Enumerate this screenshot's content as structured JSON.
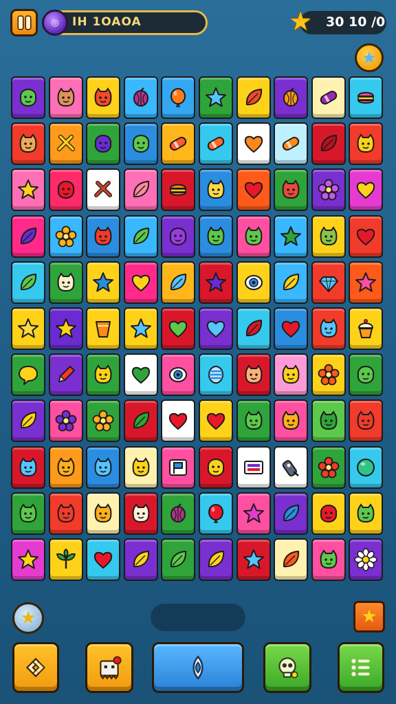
{
  "top_bar": {
    "level_text": "IH 1OAOA",
    "score_text": "30 10 /0",
    "orb_glyph": "◎"
  },
  "board": {
    "rows": [
      [
        {
          "bg": "#7a2fd0",
          "icon": "blob",
          "fg": "#5cc94a",
          "name": "green-blob-icon"
        },
        {
          "bg": "#ff6fb5",
          "icon": "face",
          "fg": "#e0925a",
          "name": "tan-face-icon"
        },
        {
          "bg": "#ffd21a",
          "icon": "face",
          "fg": "#f24a2a",
          "name": "red-face-icon"
        },
        {
          "bg": "#39b7ff",
          "icon": "fruit",
          "fg": "#b0348a",
          "name": "purple-fruit-icon"
        },
        {
          "bg": "#34a7f2",
          "icon": "balloon",
          "fg": "#ff7a1a",
          "name": "orange-balloon-icon"
        },
        {
          "bg": "#2fa43a",
          "icon": "star",
          "fg": "#56c4ff",
          "name": "blue-star-icon"
        },
        {
          "bg": "#ffd21a",
          "icon": "leaf",
          "fg": "#f24a2a",
          "name": "red-leaf-icon"
        },
        {
          "bg": "#7a2fd0",
          "icon": "fruit",
          "fg": "#ff9a1a",
          "name": "orange-fruit-icon"
        },
        {
          "bg": "#fff2b0",
          "icon": "capsule",
          "fg": "#9a2ab3",
          "name": "capsule-icon"
        },
        {
          "bg": "#36c9ee",
          "icon": "burger",
          "fg": "#e44ea0",
          "name": "burger-icon"
        }
      ],
      [
        {
          "bg": "#f23b2a",
          "icon": "face",
          "fg": "#f0a85a",
          "name": "cat-face-icon"
        },
        {
          "bg": "#ff9a1a",
          "icon": "cross",
          "fg": "#ffd21a",
          "name": "crossed-tools-icon"
        },
        {
          "bg": "#2fa43a",
          "icon": "blob",
          "fg": "#6a2bd0",
          "name": "purple-blob-icon"
        },
        {
          "bg": "#2b8de0",
          "icon": "blob",
          "fg": "#5cc94a",
          "name": "green-blob-icon"
        },
        {
          "bg": "#ffb61a",
          "icon": "capsule",
          "fg": "#ff5a2a",
          "name": "candy-icon"
        },
        {
          "bg": "#36c9ee",
          "icon": "capsule",
          "fg": "#ff6a2a",
          "name": "sausage-icon"
        },
        {
          "bg": "#ffffff",
          "icon": "heart",
          "fg": "#ff8a1a",
          "name": "orange-heart-icon"
        },
        {
          "bg": "#bff0ff",
          "icon": "capsule",
          "fg": "#ff8a1a",
          "name": "orange-candy-icon"
        },
        {
          "bg": "#d8182a",
          "icon": "leaf",
          "fg": "#b81020",
          "name": "red-leaf-icon"
        },
        {
          "bg": "#f23b2a",
          "icon": "face",
          "fg": "#ffd21a",
          "name": "yellow-face-icon"
        }
      ],
      [
        {
          "bg": "#ff6fb5",
          "icon": "star",
          "fg": "#ffd21a",
          "name": "yellow-star-icon"
        },
        {
          "bg": "#ff2a6a",
          "icon": "blob",
          "fg": "#e8182a",
          "name": "red-blob-icon"
        },
        {
          "bg": "#ffffff",
          "icon": "cross",
          "fg": "#c7442a",
          "name": "crossed-tools-icon"
        },
        {
          "bg": "#ff6fb5",
          "icon": "leaf",
          "fg": "#ff8aa0",
          "name": "pink-leaf-icon"
        },
        {
          "bg": "#d8182a",
          "icon": "burger",
          "fg": "#ff8a1a",
          "name": "orange-burger-icon"
        },
        {
          "bg": "#2b8de0",
          "icon": "face",
          "fg": "#ffd84a",
          "name": "bear-face-icon"
        },
        {
          "bg": "#ff5a1a",
          "icon": "heart",
          "fg": "#e8182a",
          "name": "red-heart-icon"
        },
        {
          "bg": "#2fa43a",
          "icon": "face",
          "fg": "#e84a3a",
          "name": "red-face-icon"
        },
        {
          "bg": "#7a2fd0",
          "icon": "flower",
          "fg": "#c05ae8",
          "name": "purple-flower-icon"
        },
        {
          "bg": "#e53bd0",
          "icon": "heart",
          "fg": "#ffd21a",
          "name": "yellow-heart-icon"
        }
      ],
      [
        {
          "bg": "#ff2a8a",
          "icon": "leaf",
          "fg": "#6a2bd0",
          "name": "purple-leaf-icon"
        },
        {
          "bg": "#39b7ff",
          "icon": "flower",
          "fg": "#ffb01a",
          "name": "orange-flower-icon"
        },
        {
          "bg": "#2b8de0",
          "icon": "face",
          "fg": "#f23b2a",
          "name": "red-face-icon"
        },
        {
          "bg": "#39b7ff",
          "icon": "leaf",
          "fg": "#5cc94a",
          "name": "green-leaf-icon"
        },
        {
          "bg": "#7a2fd0",
          "icon": "blob",
          "fg": "#9a3ae0",
          "name": "purple-blob-icon"
        },
        {
          "bg": "#2b8de0",
          "icon": "face",
          "fg": "#5cc94a",
          "name": "green-face-icon"
        },
        {
          "bg": "#ff4fa0",
          "icon": "face",
          "fg": "#5cc94a",
          "name": "green-face-icon"
        },
        {
          "bg": "#39b7ff",
          "icon": "star",
          "fg": "#2fa43a",
          "name": "green-star-icon"
        },
        {
          "bg": "#ffd21a",
          "icon": "face",
          "fg": "#8ac44a",
          "name": "cat-face-icon"
        },
        {
          "bg": "#f23b2a",
          "icon": "heart",
          "fg": "#e8182a",
          "name": "red-heart-icon"
        }
      ],
      [
        {
          "bg": "#36c9ee",
          "icon": "leaf",
          "fg": "#5cc94a",
          "name": "green-leaf-icon"
        },
        {
          "bg": "#2fa43a",
          "icon": "face",
          "fg": "#f6f0c8",
          "name": "white-face-icon"
        },
        {
          "bg": "#ffd21a",
          "icon": "star",
          "fg": "#2b8de0",
          "name": "blue-star-icon"
        },
        {
          "bg": "#ff2a8a",
          "icon": "heart",
          "fg": "#ffd21a",
          "name": "yellow-heart-icon"
        },
        {
          "bg": "#ffb61a",
          "icon": "leaf",
          "fg": "#56c4ff",
          "name": "blue-leaf-icon"
        },
        {
          "bg": "#d8182a",
          "icon": "star",
          "fg": "#6a2bd0",
          "name": "purple-star-icon"
        },
        {
          "bg": "#ffd21a",
          "icon": "eye",
          "fg": "#2b8de0",
          "name": "eye-icon"
        },
        {
          "bg": "#39b7ff",
          "icon": "leaf",
          "fg": "#ffd21a",
          "name": "yellow-leaf-icon"
        },
        {
          "bg": "#f23b2a",
          "icon": "gem",
          "fg": "#56c4ff",
          "name": "blue-gem-icon"
        },
        {
          "bg": "#ff5a1a",
          "icon": "star",
          "fg": "#ff4fa0",
          "name": "pink-star-icon"
        }
      ],
      [
        {
          "bg": "#ffd21a",
          "icon": "star",
          "fg": "#ffd84a",
          "name": "yellow-star-icon"
        },
        {
          "bg": "#6a2bd0",
          "icon": "star",
          "fg": "#ffd21a",
          "name": "yellow-star-icon"
        },
        {
          "bg": "#ffd21a",
          "icon": "cup",
          "fg": "#ff8a1a",
          "name": "orange-cup-icon"
        },
        {
          "bg": "#ffd21a",
          "icon": "star",
          "fg": "#56c4ff",
          "name": "blue-star-icon"
        },
        {
          "bg": "#d8182a",
          "icon": "heart",
          "fg": "#5cc94a",
          "name": "green-heart-icon"
        },
        {
          "bg": "#7a2fd0",
          "icon": "heart",
          "fg": "#56c4ff",
          "name": "blue-heart-icon"
        },
        {
          "bg": "#36c9ee",
          "icon": "leaf",
          "fg": "#d8182a",
          "name": "red-leaf-icon"
        },
        {
          "bg": "#2b8de0",
          "icon": "heart",
          "fg": "#e8182a",
          "name": "red-heart-icon"
        },
        {
          "bg": "#f23b2a",
          "icon": "face",
          "fg": "#56c4ff",
          "name": "blue-face-icon"
        },
        {
          "bg": "#ffd21a",
          "icon": "cupcake",
          "fg": "#ff9a1a",
          "name": "cupcake-icon"
        }
      ],
      [
        {
          "bg": "#2fa43a",
          "icon": "bubble",
          "fg": "#ffd21a",
          "name": "speech-bubble-icon"
        },
        {
          "bg": "#7a2fd0",
          "icon": "pencil",
          "fg": "#f23b2a",
          "name": "pencil-icon"
        },
        {
          "bg": "#2fa43a",
          "icon": "face",
          "fg": "#ffd21a",
          "name": "yellow-face-icon"
        },
        {
          "bg": "#ffffff",
          "icon": "heart",
          "fg": "#2fa43a",
          "name": "green-heart-icon"
        },
        {
          "bg": "#ff4fa0",
          "icon": "eye",
          "fg": "#2b8de0",
          "name": "eye-icon"
        },
        {
          "bg": "#36c9ee",
          "icon": "egg",
          "fg": "#2b8de0",
          "name": "striped-egg-icon"
        },
        {
          "bg": "#d8182a",
          "icon": "face",
          "fg": "#ffb07a",
          "name": "peach-face-icon"
        },
        {
          "bg": "#ff9ad8",
          "icon": "face",
          "fg": "#ffd21a",
          "name": "yellow-face-icon"
        },
        {
          "bg": "#ffd21a",
          "icon": "flower",
          "fg": "#ff5a1a",
          "name": "orange-flower-icon"
        },
        {
          "bg": "#2fa43a",
          "icon": "blob",
          "fg": "#5cc94a",
          "name": "green-blob-icon"
        }
      ],
      [
        {
          "bg": "#7a2fd0",
          "icon": "leaf",
          "fg": "#ffd21a",
          "name": "yellow-leaf-icon"
        },
        {
          "bg": "#ff4fa0",
          "icon": "flower",
          "fg": "#7a2fd0",
          "name": "purple-flower-icon"
        },
        {
          "bg": "#2fa43a",
          "icon": "flower",
          "fg": "#ffb01a",
          "name": "orange-flower-icon"
        },
        {
          "bg": "#d8182a",
          "icon": "leaf",
          "fg": "#2fa43a",
          "name": "green-leaf-icon"
        },
        {
          "bg": "#ffffff",
          "icon": "heart",
          "fg": "#e8182a",
          "name": "red-heart-icon"
        },
        {
          "bg": "#ffd21a",
          "icon": "heart",
          "fg": "#e8182a",
          "name": "red-heart-icon"
        },
        {
          "bg": "#2fa43a",
          "icon": "face",
          "fg": "#5cc94a",
          "name": "green-face-icon"
        },
        {
          "bg": "#ff4fa0",
          "icon": "face",
          "fg": "#ffb01a",
          "name": "orange-face-icon"
        },
        {
          "bg": "#5cc94a",
          "icon": "face",
          "fg": "#2fa43a",
          "name": "green-face-icon"
        },
        {
          "bg": "#f23b2a",
          "icon": "face",
          "fg": "#f23b2a",
          "name": "red-face-icon"
        }
      ],
      [
        {
          "bg": "#d8182a",
          "icon": "face",
          "fg": "#56c4ff",
          "name": "blue-face-icon"
        },
        {
          "bg": "#ff9a1a",
          "icon": "face",
          "fg": "#ffb01a",
          "name": "orange-face-icon"
        },
        {
          "bg": "#2b8de0",
          "icon": "face",
          "fg": "#56c4ff",
          "name": "blue-face-icon"
        },
        {
          "bg": "#fff2b0",
          "icon": "face",
          "fg": "#ffd21a",
          "name": "yellow-face-icon"
        },
        {
          "bg": "#ff4fa0",
          "icon": "flag",
          "fg": "#2b8de0",
          "name": "flag-icon"
        },
        {
          "bg": "#d8182a",
          "icon": "blob",
          "fg": "#ffd21a",
          "name": "yellow-blob-icon"
        },
        {
          "bg": "#ffffff",
          "icon": "card",
          "fg": "#6a2bd0",
          "name": "card-icon"
        },
        {
          "bg": "#ffffff",
          "icon": "key",
          "fg": "#5a6a7a",
          "name": "key-icon"
        },
        {
          "bg": "#2fa43a",
          "icon": "flower",
          "fg": "#f23b2a",
          "name": "red-flower-icon"
        },
        {
          "bg": "#36c9ee",
          "icon": "ball",
          "fg": "#2fc48a",
          "name": "green-ball-icon"
        }
      ],
      [
        {
          "bg": "#2fa43a",
          "icon": "face",
          "fg": "#5cc94a",
          "name": "green-face-icon"
        },
        {
          "bg": "#f23b2a",
          "icon": "face",
          "fg": "#f23b2a",
          "name": "red-face-icon"
        },
        {
          "bg": "#fff2b0",
          "icon": "face",
          "fg": "#ffb01a",
          "name": "orange-face-icon"
        },
        {
          "bg": "#d8182a",
          "icon": "face",
          "fg": "#fff0d8",
          "name": "white-face-icon"
        },
        {
          "bg": "#2fa43a",
          "icon": "fruit",
          "fg": "#b0348a",
          "name": "berry-icon"
        },
        {
          "bg": "#36c9ee",
          "icon": "balloon",
          "fg": "#e8182a",
          "name": "red-balloon-icon"
        },
        {
          "bg": "#ff4fa0",
          "icon": "star",
          "fg": "#e53bd0",
          "name": "pink-star-icon"
        },
        {
          "bg": "#7a2fd0",
          "icon": "leaf",
          "fg": "#2b8de0",
          "name": "blue-leaf-icon"
        },
        {
          "bg": "#ffd21a",
          "icon": "blob",
          "fg": "#e8182a",
          "name": "red-blob-icon"
        },
        {
          "bg": "#ffd21a",
          "icon": "face",
          "fg": "#5cc94a",
          "name": "green-face-icon"
        }
      ],
      [
        {
          "bg": "#e53bd0",
          "icon": "star",
          "fg": "#ffd21a",
          "name": "yellow-star-icon"
        },
        {
          "bg": "#ffd21a",
          "icon": "plant",
          "fg": "#2fa43a",
          "name": "plant-icon"
        },
        {
          "bg": "#36c9ee",
          "icon": "heart",
          "fg": "#e8182a",
          "name": "red-heart-icon"
        },
        {
          "bg": "#7a2fd0",
          "icon": "leaf",
          "fg": "#ffd21a",
          "name": "yellow-leaf-icon"
        },
        {
          "bg": "#2fa43a",
          "icon": "leaf",
          "fg": "#5cc94a",
          "name": "green-leaf-icon"
        },
        {
          "bg": "#7a2fd0",
          "icon": "leaf",
          "fg": "#ffd21a",
          "name": "yellow-leaf-icon"
        },
        {
          "bg": "#d8182a",
          "icon": "star",
          "fg": "#56c4ff",
          "name": "blue-star-icon"
        },
        {
          "bg": "#fff2b0",
          "icon": "leaf",
          "fg": "#ff5a1a",
          "name": "orange-leaf-icon"
        },
        {
          "bg": "#ff4fa0",
          "icon": "face",
          "fg": "#5cc94a",
          "name": "green-face-icon"
        },
        {
          "bg": "#7a2fd0",
          "icon": "daisy",
          "fg": "#ffffff",
          "name": "daisy-icon"
        }
      ]
    ]
  },
  "controls": {
    "star_glyph": "★"
  }
}
